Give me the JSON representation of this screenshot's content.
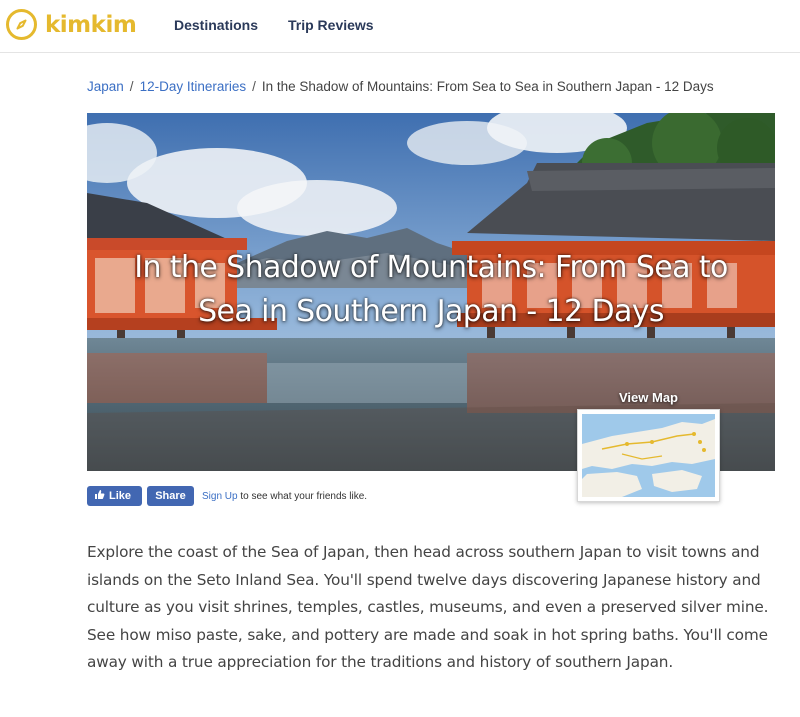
{
  "header": {
    "logo_text": "kimkim",
    "nav": [
      {
        "label": "Destinations"
      },
      {
        "label": "Trip Reviews"
      }
    ]
  },
  "breadcrumb": {
    "items": [
      "Japan",
      "12-Day Itineraries"
    ],
    "current": "In the Shadow of Mountains: From Sea to Sea in Southern Japan - 12 Days",
    "separator": "/"
  },
  "hero": {
    "title": "In the Shadow of Mountains: From Sea to Sea in Southern Japan - 12 Days",
    "view_map_label": "View Map"
  },
  "social": {
    "like_label": "Like",
    "share_label": "Share",
    "signup_link": "Sign Up",
    "signup_text": "to see what your friends like."
  },
  "description": "Explore the coast of the Sea of Japan, then head across southern Japan to visit towns and islands on the Seto Inland Sea. You'll spend twelve days discovering Japanese history and culture as you visit shrines, temples, castles, museums, and even a preserved silver mine. See how miso paste, sake, and pottery are made and soak in hot spring baths. You'll come away with a true appreciation for the traditions and history of southern Japan.",
  "colors": {
    "brand": "#e5b92e",
    "nav_text": "#2b3a5a",
    "link": "#3b6fc4",
    "facebook": "#4267b2"
  }
}
